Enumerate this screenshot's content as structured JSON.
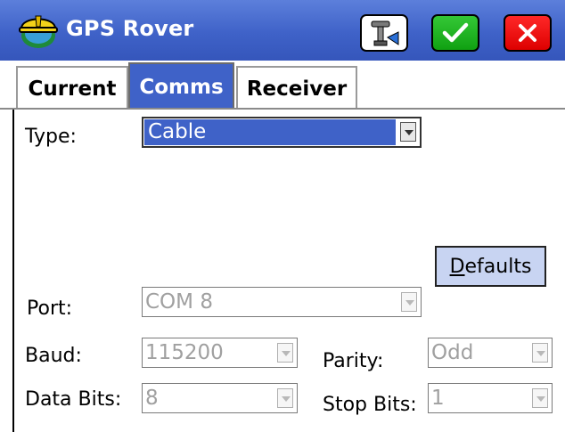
{
  "window": {
    "title": "GPS Rover",
    "buttons": {
      "settings_icon": "antenna-settings-icon",
      "ok_icon": "checkmark-icon",
      "cancel_icon": "close-icon"
    }
  },
  "tabs": [
    {
      "label": "Current",
      "active": false
    },
    {
      "label": "Comms",
      "active": true
    },
    {
      "label": "Receiver",
      "active": false
    }
  ],
  "form": {
    "type": {
      "label": "Type:",
      "value": "Cable",
      "enabled": true
    },
    "defaults_button": {
      "underline": "D",
      "rest": "efaults"
    },
    "port": {
      "label": "Port:",
      "value": "COM 8",
      "enabled": false
    },
    "baud": {
      "label": "Baud:",
      "value": "115200",
      "enabled": false
    },
    "parity": {
      "label": "Parity:",
      "value": "Odd",
      "enabled": false
    },
    "data_bits": {
      "label": "Data Bits:",
      "value": "8",
      "enabled": false
    },
    "stop_bits": {
      "label": "Stop Bits:",
      "value": "1",
      "enabled": false
    }
  },
  "colors": {
    "titlebar": "#3f62c8",
    "active_tab": "#3f62c8",
    "ok_button": "#22b422",
    "cancel_button": "#ee0000",
    "defaults_button": "#c8d4f2"
  }
}
